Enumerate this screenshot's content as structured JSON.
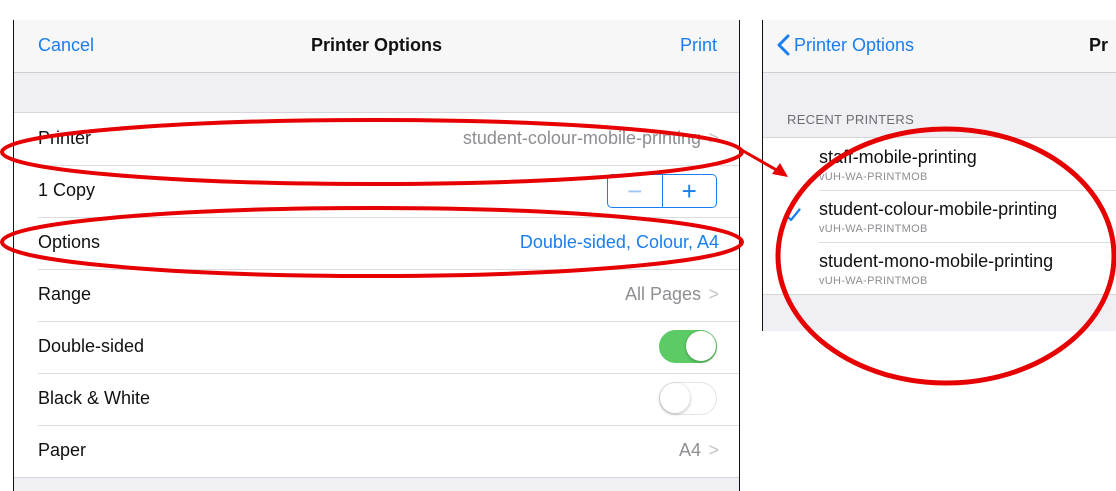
{
  "left": {
    "nav": {
      "cancel": "Cancel",
      "title": "Printer Options",
      "print": "Print"
    },
    "rows": {
      "printer": {
        "label": "Printer",
        "value": "student-colour-mobile-printing"
      },
      "copies": {
        "label": "1 Copy",
        "minus": "−",
        "plus": "+"
      },
      "options": {
        "label": "Options",
        "value": "Double-sided, Colour, A4"
      },
      "range": {
        "label": "Range",
        "value": "All Pages"
      },
      "double_sided": {
        "label": "Double-sided",
        "on": true
      },
      "black_white": {
        "label": "Black & White",
        "on": false
      },
      "paper": {
        "label": "Paper",
        "value": "A4"
      }
    },
    "chevron": ">"
  },
  "right": {
    "nav": {
      "back": "Printer Options",
      "title": "Pr"
    },
    "section": "RECENT PRINTERS",
    "printers": [
      {
        "name": "staff-mobile-printing",
        "server": "vUH-WA-PRINTMOB",
        "selected": false
      },
      {
        "name": "student-colour-mobile-printing",
        "server": "vUH-WA-PRINTMOB",
        "selected": true
      },
      {
        "name": "student-mono-mobile-printing",
        "server": "vUH-WA-PRINTMOB",
        "selected": false
      }
    ]
  },
  "colors": {
    "accent": "#1a7ef0",
    "toggle_on": "#5ccb65",
    "annotation": "#e60000"
  }
}
